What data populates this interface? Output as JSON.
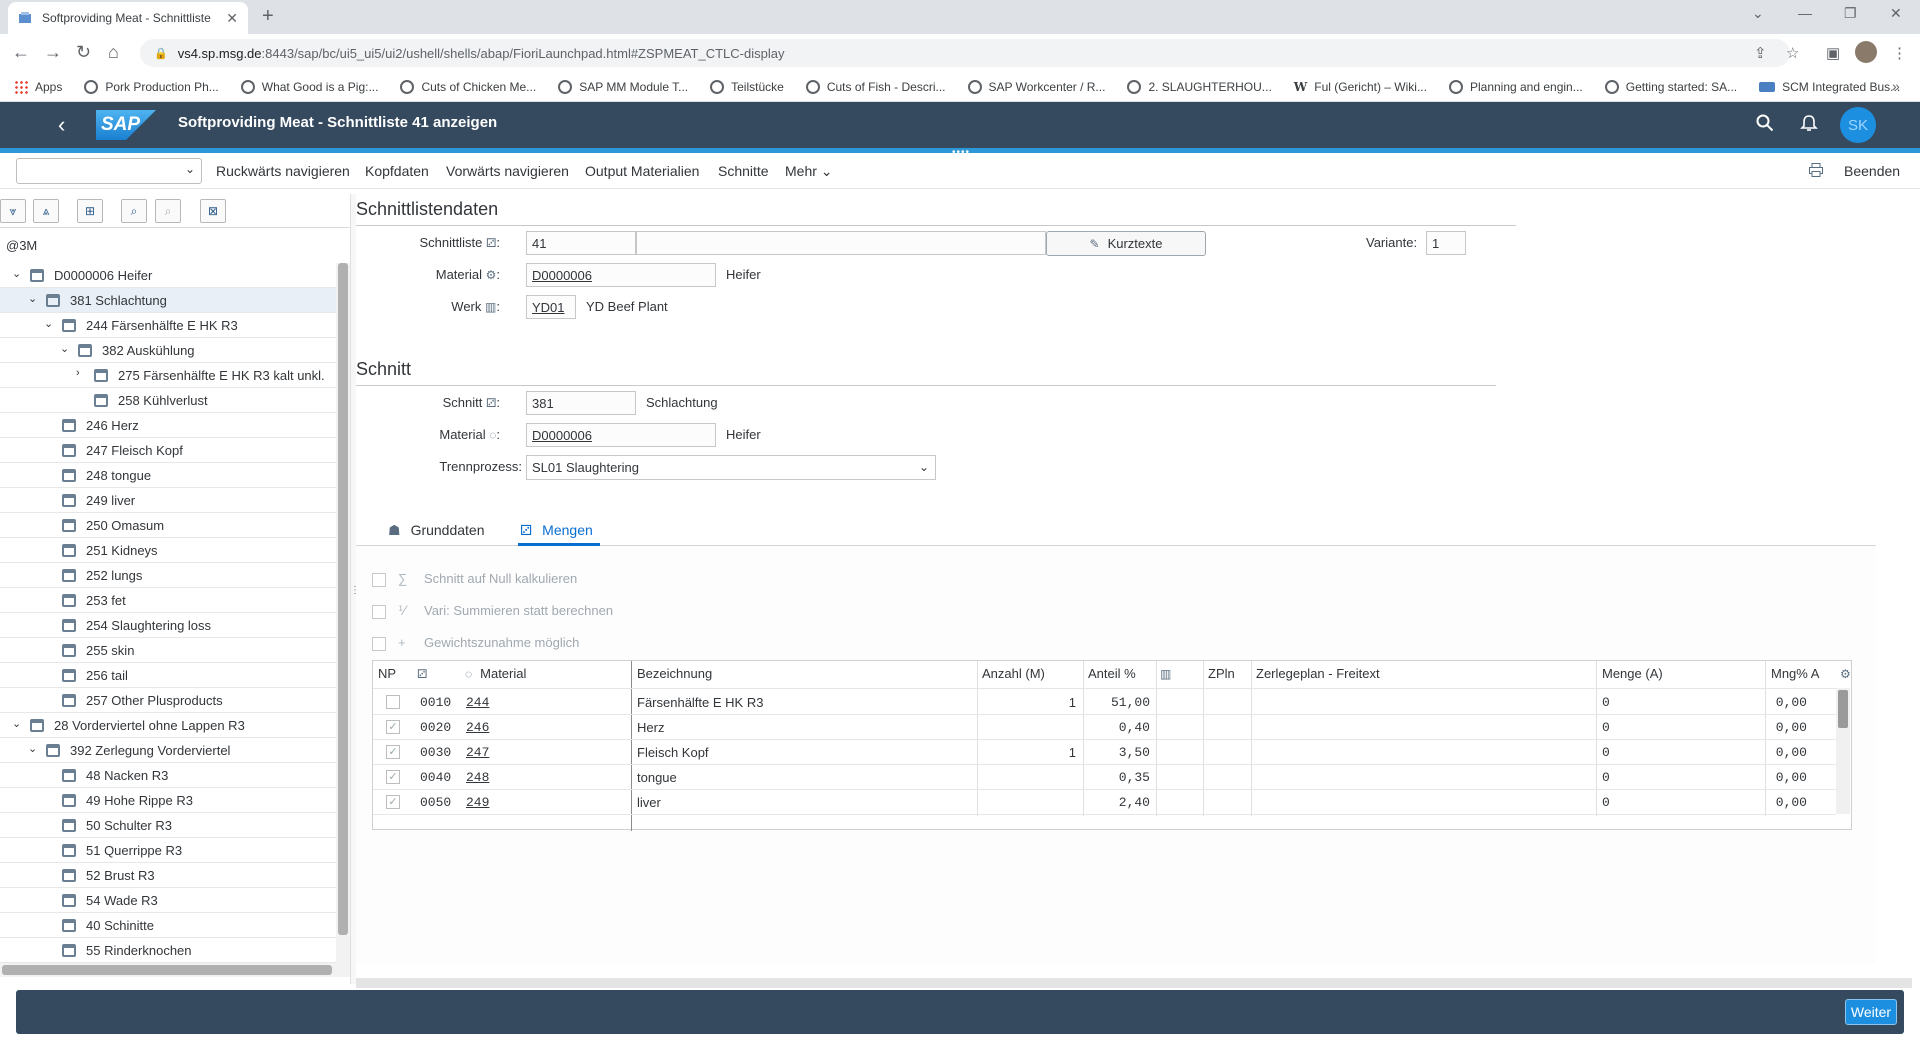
{
  "browser": {
    "tab_title": "Softproviding Meat - Schnittliste",
    "new_tab": "+",
    "url_host": "vs4.sp.msg.de",
    "url_path": ":8443/sap/bc/ui5_ui5/ui2/ushell/shells/abap/FioriLaunchpad.html#ZSPMEAT_CTLC-display",
    "bookmarks": [
      "Apps",
      "Pork Production Ph...",
      "What Good is a Pig:...",
      "Cuts of Chicken Me...",
      "SAP MM Module T...",
      "Teilstücke",
      "Cuts of Fish - Descri...",
      "SAP Workcenter / R...",
      "2. SLAUGHTERHOU...",
      "Ful (Gericht) – Wiki...",
      "Planning and engin...",
      "Getting started: SA...",
      "SCM Integrated Bus..."
    ],
    "bookmarks_more": "»"
  },
  "shell": {
    "logo": "SAP",
    "title": "Softproviding Meat - Schnittliste 41 anzeigen",
    "avatar": "SK"
  },
  "toolbar": {
    "items": [
      "Ruckwärts navigieren",
      "Kopfdaten",
      "Vorwärts navigieren",
      "Output Materialien",
      "Schnitte",
      "Mehr"
    ],
    "beenden": "Beenden"
  },
  "tree": {
    "root_label": "@3M",
    "rows": [
      {
        "label": "D0000006 Heifer",
        "level": 0,
        "expander": "v"
      },
      {
        "label": "381 Schlachtung",
        "level": 1,
        "expander": "v",
        "selected": true
      },
      {
        "label": "244 Färsenhälfte E HK R3",
        "level": 2,
        "expander": "v"
      },
      {
        "label": "382 Auskühlung",
        "level": 3,
        "expander": "v"
      },
      {
        "label": "275 Färsenhälfte E HK R3 kalt unkl.",
        "level": 4,
        "expander": ">"
      },
      {
        "label": "258 Kühlverlust",
        "level": 4,
        "expander": ""
      },
      {
        "label": "246 Herz",
        "level": 2,
        "expander": ""
      },
      {
        "label": "247 Fleisch Kopf",
        "level": 2,
        "expander": ""
      },
      {
        "label": "248 tongue",
        "level": 2,
        "expander": ""
      },
      {
        "label": "249 liver",
        "level": 2,
        "expander": ""
      },
      {
        "label": "250 Omasum",
        "level": 2,
        "expander": ""
      },
      {
        "label": "251 Kidneys",
        "level": 2,
        "expander": ""
      },
      {
        "label": "252 lungs",
        "level": 2,
        "expander": ""
      },
      {
        "label": "253 fet",
        "level": 2,
        "expander": ""
      },
      {
        "label": "254 Slaughtering loss",
        "level": 2,
        "expander": ""
      },
      {
        "label": "255 skin",
        "level": 2,
        "expander": ""
      },
      {
        "label": "256 tail",
        "level": 2,
        "expander": ""
      },
      {
        "label": "257 Other Plusproducts",
        "level": 2,
        "expander": ""
      },
      {
        "label": "28 Vorderviertel ohne Lappen R3",
        "level": 0,
        "expander": "v"
      },
      {
        "label": "392 Zerlegung Vorderviertel",
        "level": 1,
        "expander": "v"
      },
      {
        "label": "48 Nacken R3",
        "level": 2,
        "expander": ""
      },
      {
        "label": "49 Hohe Rippe R3",
        "level": 2,
        "expander": ""
      },
      {
        "label": "50 Schulter R3",
        "level": 2,
        "expander": ""
      },
      {
        "label": "51 Querrippe R3",
        "level": 2,
        "expander": ""
      },
      {
        "label": "52 Brust R3",
        "level": 2,
        "expander": ""
      },
      {
        "label": "54 Wade R3",
        "level": 2,
        "expander": ""
      },
      {
        "label": "40 Schinitte",
        "level": 2,
        "expander": ""
      },
      {
        "label": "55 Rinderknochen",
        "level": 2,
        "expander": ""
      }
    ]
  },
  "header_section": {
    "title": "Schnittlistendaten",
    "schnittliste_label": "Schnittliste",
    "schnittliste_value": "41",
    "kurztexte": "Kurztexte",
    "variante_label": "Variante:",
    "variante_value": "1",
    "material_label": "Material",
    "material_value": "D0000006",
    "material_desc": "Heifer",
    "werk_label": "Werk",
    "werk_value": "YD01",
    "werk_desc": "YD Beef Plant"
  },
  "schnitt_section": {
    "title": "Schnitt",
    "schnitt_label": "Schnitt",
    "schnitt_value": "381",
    "schnitt_desc": "Schlachtung",
    "material_label": "Material",
    "material_value": "D0000006",
    "material_desc": "Heifer",
    "trenn_label": "Trennprozess:",
    "trenn_value": "SL01 Slaughtering"
  },
  "tabs": [
    {
      "label": "Grunddaten",
      "active": false
    },
    {
      "label": "Mengen",
      "active": true
    }
  ],
  "options": [
    "Schnitt auf Null kalkulieren",
    "Vari: Summieren statt berechnen",
    "Gewichtszunahme möglich"
  ],
  "table": {
    "headers": {
      "np": "NP",
      "material": "Material",
      "bezeichnung": "Bezeichnung",
      "anzahl": "Anzahl (M)",
      "anteil": "Anteil %",
      "zpln": "ZPln",
      "freitext": "Zerlegeplan - Freitext",
      "menge": "Menge (A)",
      "mng": "Mng% A"
    },
    "rows": [
      {
        "checked": false,
        "pos": "0010",
        "material": "244",
        "bezeichnung": "Färsenhälfte E HK R3",
        "anzahl": "1",
        "anteil": "51,00",
        "menge": "0",
        "mng": "0,00"
      },
      {
        "checked": true,
        "pos": "0020",
        "material": "246",
        "bezeichnung": "Herz",
        "anzahl": "",
        "anteil": "0,40",
        "menge": "0",
        "mng": "0,00"
      },
      {
        "checked": true,
        "pos": "0030",
        "material": "247",
        "bezeichnung": "Fleisch Kopf",
        "anzahl": "1",
        "anteil": "3,50",
        "menge": "0",
        "mng": "0,00"
      },
      {
        "checked": true,
        "pos": "0040",
        "material": "248",
        "bezeichnung": "tongue",
        "anzahl": "",
        "anteil": "0,35",
        "menge": "0",
        "mng": "0,00"
      },
      {
        "checked": true,
        "pos": "0050",
        "material": "249",
        "bezeichnung": "liver",
        "anzahl": "",
        "anteil": "2,40",
        "menge": "0",
        "mng": "0,00"
      }
    ]
  },
  "status": {
    "weiter": "Weiter"
  }
}
